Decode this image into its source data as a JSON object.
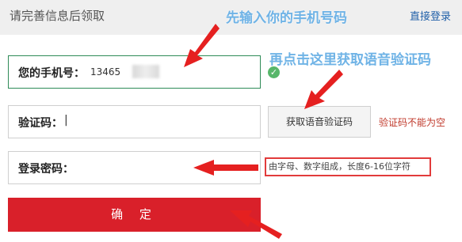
{
  "header": {
    "title": "请完善信息后领取",
    "direct_login": "直接登录"
  },
  "annotations": {
    "step1": "先输入你的手机号码",
    "step2": "再点击这里获取语音验证码"
  },
  "form": {
    "phone_label": "您的手机号：",
    "phone_value": "13465",
    "code_label": "验证码：",
    "code_value": "|",
    "voice_button": "获取语音验证码",
    "code_error": "验证码不能为空",
    "password_label": "登录密码：",
    "password_hint": "由字母、数字组成，长度6-16位字符",
    "confirm_button": "确 定"
  },
  "colors": {
    "accent_red": "#d9202a",
    "link_blue": "#1f5fa8",
    "annotation_blue": "#6fb3e6"
  },
  "icons": [
    "check-icon",
    "arrow-icon"
  ]
}
